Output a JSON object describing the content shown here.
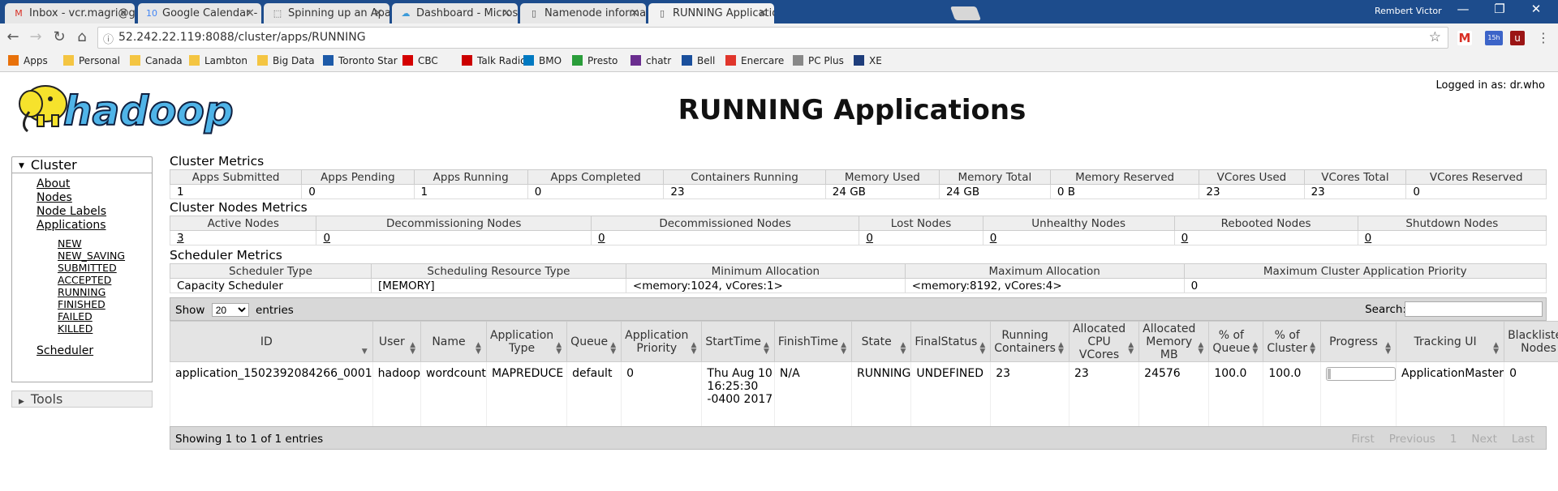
{
  "browser": {
    "tabs": [
      {
        "label": "Inbox - vcr.magri@gmail",
        "icon": "gmail-icon",
        "icon_char": "M",
        "icon_color": "#d93025"
      },
      {
        "label": "Google Calendar - Month",
        "icon": "calendar-icon",
        "icon_char": "10",
        "icon_color": "#4285f4"
      },
      {
        "label": "Spinning up an Apache S",
        "icon": "page-icon",
        "icon_char": "⬚",
        "icon_color": "#555"
      },
      {
        "label": "Dashboard - Microsoft A",
        "icon": "cloud-icon",
        "icon_char": "☁",
        "icon_color": "#3b9ad9"
      },
      {
        "label": "Namenode information",
        "icon": "page-icon",
        "icon_char": "▯",
        "icon_color": "#555"
      },
      {
        "label": "RUNNING Applications",
        "icon": "page-icon",
        "icon_char": "▯",
        "icon_color": "#555",
        "active": true
      }
    ],
    "tab_close": "×",
    "profile_name": "Rembert Victor",
    "window_controls": {
      "minimize": "—",
      "restore": "❐",
      "close": "✕"
    },
    "url": "52.242.22.119:8088/cluster/apps/RUNNING",
    "bookmarks": [
      {
        "label": "Apps",
        "icon": "apps-grid-icon"
      },
      {
        "label": "Personal",
        "icon": "folder-icon"
      },
      {
        "label": "Canada",
        "icon": "folder-icon"
      },
      {
        "label": "Lambton",
        "icon": "folder-icon"
      },
      {
        "label": "Big Data",
        "icon": "folder-icon"
      },
      {
        "label": "Toronto Star",
        "icon": "star-site-icon"
      },
      {
        "label": "CBC",
        "icon": "cbc-icon"
      },
      {
        "label": "Talk Radio",
        "icon": "radio-icon"
      },
      {
        "label": "BMO",
        "icon": "bmo-icon"
      },
      {
        "label": "Presto",
        "icon": "presto-icon"
      },
      {
        "label": "chatr",
        "icon": "chatr-icon"
      },
      {
        "label": "Bell",
        "icon": "bell-icon"
      },
      {
        "label": "Enercare",
        "icon": "enercare-icon"
      },
      {
        "label": "PC Plus",
        "icon": "page-icon"
      },
      {
        "label": "XE",
        "icon": "xe-icon"
      }
    ],
    "extension_badge": "15h"
  },
  "header": {
    "logo_text": "hadoop",
    "title": "RUNNING Applications",
    "logged_in": "Logged in as: dr.who"
  },
  "sidebar": {
    "cluster_label": "Cluster",
    "links": [
      "About",
      "Nodes",
      "Node Labels",
      "Applications"
    ],
    "app_states": [
      "NEW",
      "NEW_SAVING",
      "SUBMITTED",
      "ACCEPTED",
      "RUNNING",
      "FINISHED",
      "FAILED",
      "KILLED"
    ],
    "scheduler": "Scheduler",
    "tools_label": "Tools"
  },
  "cluster_metrics": {
    "title": "Cluster Metrics",
    "headers": [
      "Apps Submitted",
      "Apps Pending",
      "Apps Running",
      "Apps Completed",
      "Containers Running",
      "Memory Used",
      "Memory Total",
      "Memory Reserved",
      "VCores Used",
      "VCores Total",
      "VCores Reserved"
    ],
    "values": [
      "1",
      "0",
      "1",
      "0",
      "23",
      "24 GB",
      "24 GB",
      "0 B",
      "23",
      "23",
      "0"
    ]
  },
  "nodes_metrics": {
    "title": "Cluster Nodes Metrics",
    "headers": [
      "Active Nodes",
      "Decommissioning Nodes",
      "Decommissioned Nodes",
      "Lost Nodes",
      "Unhealthy Nodes",
      "Rebooted Nodes",
      "Shutdown Nodes"
    ],
    "values": [
      "3",
      "0",
      "0",
      "0",
      "0",
      "0",
      "0"
    ]
  },
  "scheduler_metrics": {
    "title": "Scheduler Metrics",
    "headers": [
      "Scheduler Type",
      "Scheduling Resource Type",
      "Minimum Allocation",
      "Maximum Allocation",
      "Maximum Cluster Application Priority"
    ],
    "values": [
      "Capacity Scheduler",
      "[MEMORY]",
      "<memory:1024, vCores:1>",
      "<memory:8192, vCores:4>",
      "0"
    ]
  },
  "apps_table": {
    "show_label": "Show",
    "entries_value": "20",
    "entries_label": "entries",
    "search_label": "Search:",
    "headers": [
      "ID",
      "User",
      "Name",
      "Application Type",
      "Queue",
      "Application Priority",
      "StartTime",
      "FinishTime",
      "State",
      "FinalStatus",
      "Running Containers",
      "Allocated CPU VCores",
      "Allocated Memory MB",
      "% of Queue",
      "% of Cluster",
      "Progress",
      "Tracking UI",
      "Blacklisted Nodes"
    ],
    "row": {
      "id": "application_1502392084266_0001",
      "user": "hadoop",
      "name": "wordcount",
      "type": "MAPREDUCE",
      "queue": "default",
      "priority": "0",
      "start_time": "Thu Aug 10 16:25:30 -0400 2017",
      "finish_time": "N/A",
      "state": "RUNNING",
      "final_status": "UNDEFINED",
      "running_containers": "23",
      "cpu_vcores": "23",
      "memory_mb": "24576",
      "pct_queue": "100.0",
      "pct_cluster": "100.0",
      "progress_fraction": 0.05,
      "tracking_ui": "ApplicationMaster",
      "blacklisted": "0"
    },
    "info": "Showing 1 to 1 of 1 entries",
    "pager": [
      "First",
      "Previous",
      "1",
      "Next",
      "Last"
    ]
  }
}
